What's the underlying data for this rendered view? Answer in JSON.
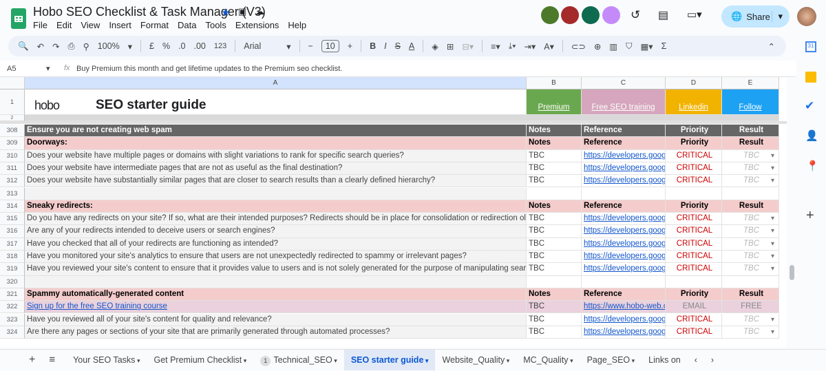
{
  "app": {
    "title": "Hobo SEO Checklist & Task Manager (V3)",
    "menu": [
      "File",
      "Edit",
      "View",
      "Insert",
      "Format",
      "Data",
      "Tools",
      "Extensions",
      "Help"
    ],
    "share_label": "Share"
  },
  "toolbar": {
    "zoom": "100%",
    "currency": "£",
    "percent": "%",
    "dec_decrease": ".0",
    "dec_increase": ".00",
    "format_123": "123",
    "font": "Arial",
    "font_size": "10",
    "bold": "B",
    "italic": "I",
    "sum": "Σ"
  },
  "formula_bar": {
    "cell_ref": "A5",
    "fx": "fx",
    "content": "Buy Premium this month and get lifetime updates to the Premium seo checklist."
  },
  "columns": [
    "A",
    "B",
    "C",
    "D",
    "E"
  ],
  "header_row": {
    "logo": "hobo",
    "title": "SEO starter guide",
    "links": [
      {
        "label": "Premium",
        "color": "#6aa84f"
      },
      {
        "label": "Free SEO training",
        "color": "#d5a6bd"
      },
      {
        "label": "Linkedin",
        "color": "#f1b300"
      },
      {
        "label": "Follow",
        "color": "#1da1f2"
      }
    ]
  },
  "rows": [
    {
      "n": "308",
      "type": "section",
      "cells": [
        "Ensure you are not creating web spam",
        "Notes",
        "Reference",
        "Priority",
        "Result"
      ]
    },
    {
      "n": "309",
      "type": "sub",
      "cells": [
        "Doorways:",
        "Notes",
        "Reference",
        "Priority",
        "Result"
      ]
    },
    {
      "n": "310",
      "type": "item",
      "cells": [
        "Does your website have multiple pages or domains with slight variations to rank for specific search queries?",
        "TBC",
        "https://developers.google",
        "CRITICAL",
        "TBC"
      ]
    },
    {
      "n": "311",
      "type": "item",
      "cells": [
        "Does your website have intermediate pages that are not as useful as the final destination?",
        "TBC",
        "https://developers.google",
        "CRITICAL",
        "TBC"
      ]
    },
    {
      "n": "312",
      "type": "item",
      "cells": [
        "Does your website have substantially similar pages that are closer to search results than a clearly defined hierarchy?",
        "TBC",
        "https://developers.google",
        "CRITICAL",
        "TBC"
      ]
    },
    {
      "n": "313",
      "type": "empty",
      "cells": [
        "",
        "",
        "",
        "",
        ""
      ]
    },
    {
      "n": "314",
      "type": "sub",
      "cells": [
        "Sneaky redirects:",
        "Notes",
        "Reference",
        "Priority",
        "Result"
      ]
    },
    {
      "n": "315",
      "type": "item",
      "cells": [
        "Do you have any redirects on your site? If so, what are their intended purposes? Redirects should be in place for consolidation or redirection old content to n",
        "TBC",
        "https://developers.google",
        "CRITICAL",
        "TBC"
      ]
    },
    {
      "n": "316",
      "type": "item",
      "cells": [
        "Are any of your redirects intended to deceive users or search engines?",
        "TBC",
        "https://developers.google",
        "CRITICAL",
        "TBC"
      ]
    },
    {
      "n": "317",
      "type": "item",
      "cells": [
        "Have you checked that all of your redirects are functioning as intended?",
        "TBC",
        "https://developers.google",
        "CRITICAL",
        "TBC"
      ]
    },
    {
      "n": "318",
      "type": "item",
      "cells": [
        "Have you monitored your site's analytics to ensure that users are not unexpectedly redirected to spammy or irrelevant pages?",
        "TBC",
        "https://developers.google",
        "CRITICAL",
        "TBC"
      ]
    },
    {
      "n": "319",
      "type": "item",
      "cells": [
        "Have you reviewed your site's content to ensure that it provides value to users and is not solely generated for the purpose of manipulating search rankings?",
        "TBC",
        "https://developers.google",
        "CRITICAL",
        "TBC"
      ]
    },
    {
      "n": "320",
      "type": "empty",
      "cells": [
        "",
        "",
        "",
        "",
        ""
      ]
    },
    {
      "n": "321",
      "type": "sub",
      "cells": [
        "Spammy automatically-generated content",
        "Notes",
        "Reference",
        "Priority",
        "Result"
      ]
    },
    {
      "n": "322",
      "type": "promo",
      "cells": [
        "Sign up for the free SEO training course",
        "TBC",
        "https://www.hobo-web.co",
        "EMAIL",
        "FREE"
      ]
    },
    {
      "n": "323",
      "type": "item",
      "cells": [
        "Have you reviewed all of your site's content for quality and relevance?",
        "TBC",
        "https://developers.google",
        "CRITICAL",
        "TBC"
      ]
    },
    {
      "n": "324",
      "type": "item",
      "cells": [
        "Are there any pages or sections of your site that are primarily generated through automated processes?",
        "TBC",
        "https://developers.google",
        "CRITICAL",
        "TBC"
      ]
    }
  ],
  "tabs": [
    {
      "label": "Your SEO Tasks"
    },
    {
      "label": "Get Premium Checklist"
    },
    {
      "label": "Technical_SEO",
      "badge": "1"
    },
    {
      "label": "SEO starter guide",
      "active": true
    },
    {
      "label": "Website_Quality"
    },
    {
      "label": "MC_Quality"
    },
    {
      "label": "Page_SEO"
    },
    {
      "label": "Links on"
    }
  ],
  "colors": {
    "section": "#666666",
    "sub": "#f4cccc",
    "promo": "#ead1dc",
    "critical": "#cc0000",
    "accent": "#0b57d0"
  }
}
